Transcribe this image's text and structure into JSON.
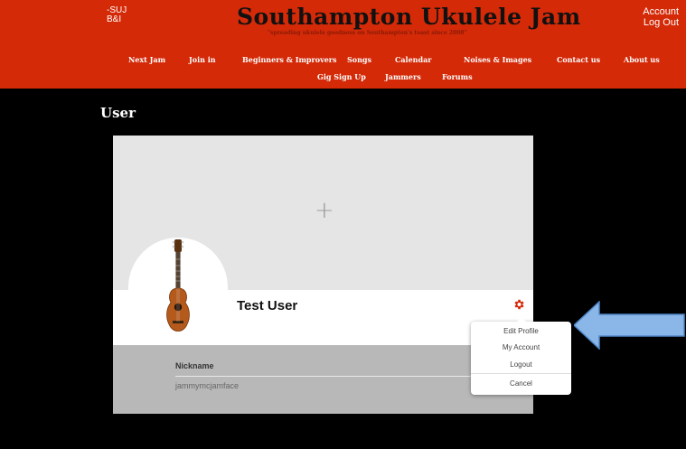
{
  "header": {
    "left_line1": "-SUJ",
    "left_line2": "B&I",
    "title": "Southampton Ukulele Jam",
    "tagline": "\"spreading ukulele goodness on Southampton's toast since 2008\"",
    "account": "Account",
    "logout": "Log Out"
  },
  "nav": {
    "row1": [
      "Next Jam",
      "Join in",
      "Beginners & Improvers",
      "Songs",
      "Calendar",
      "Noises & Images",
      "Contact us",
      "About us"
    ],
    "row2": [
      "Gig Sign Up",
      "Jammers",
      "Forums"
    ]
  },
  "page": {
    "title": "User"
  },
  "profile": {
    "cover_add_icon": "+",
    "name": "Test User",
    "settings_icon": "gear-icon",
    "nickname_label": "Nickname",
    "nickname_value": "jammymcjamface",
    "avatar_icon": "ukulele-image"
  },
  "menu": {
    "items": [
      "Edit Profile",
      "My Account",
      "Logout",
      "Cancel"
    ]
  },
  "colors": {
    "header_bg": "#d42a08",
    "gear": "#d42a08",
    "arrow_fill": "#8ab6e8"
  }
}
